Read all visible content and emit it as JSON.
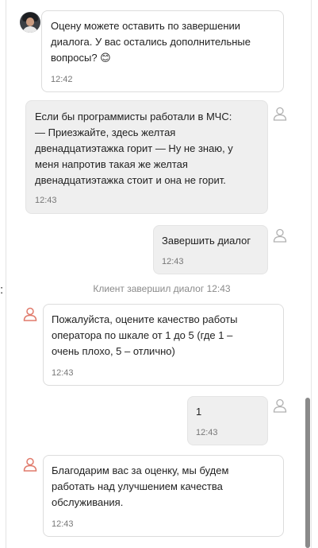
{
  "messages": [
    {
      "sender": "operator",
      "avatar": "operator-photo",
      "text": "Оцену можете оставить по завершении\nдиалога. У вас остались дополнительные\nвопросы? 😊",
      "time": "12:42"
    },
    {
      "sender": "client",
      "avatar": "person-outline-icon",
      "text": "Если бы программисты работали в МЧС:\n— Приезжайте, здесь желтая\nдвенадцатиэтажка горит — Ну не знаю, у\nменя напротив такая же желтая\nдвенадцатиэтажка стоит и она не горит.",
      "time": "12:43"
    },
    {
      "sender": "client",
      "avatar": "person-outline-icon",
      "text": "Завершить диалог",
      "time": "12:43"
    },
    {
      "sender": "bot",
      "avatar": "person-outline-icon",
      "text": "Пожалуйста, оцените качество работы\nоператора по шкале от 1 до 5 (где 1 –\nочень плохо, 5 – отлично)",
      "time": "12:43"
    },
    {
      "sender": "client",
      "avatar": "person-outline-icon",
      "text": "1",
      "time": "12:43"
    },
    {
      "sender": "bot",
      "avatar": "person-outline-icon",
      "text": "Благодарим вас за оценку, мы будем\nработать над улучшением качества\nобслуживания.",
      "time": "12:43"
    }
  ],
  "system_event": "Клиент завершил диалог 12:43",
  "left_clipped_char": ":",
  "colors": {
    "operator_bubble": "#ffffff",
    "client_bubble": "#efefef",
    "bot_icon": "#e07a6b",
    "client_icon": "#b0b0b0",
    "time_text": "#777777",
    "system_text": "#8a8a8a"
  }
}
